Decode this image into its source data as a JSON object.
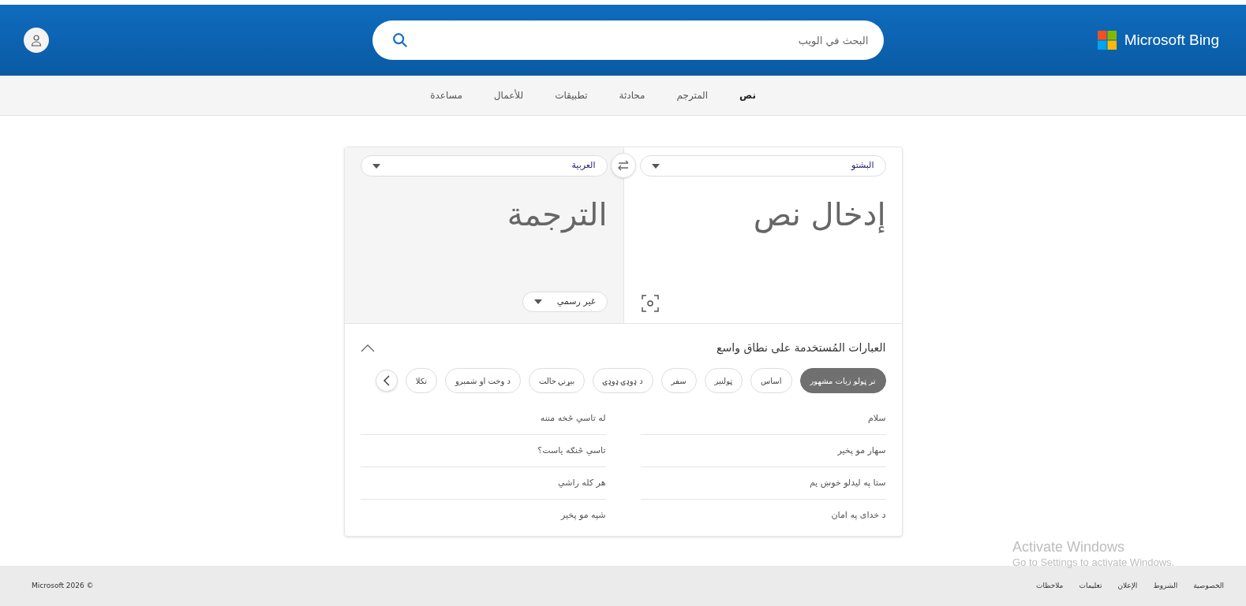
{
  "header": {
    "logo": "Microsoft Bing",
    "search": {
      "placeholder": "البحث في الويب"
    }
  },
  "nav": [
    {
      "label": "نص",
      "selected": true
    },
    {
      "label": "المترجم",
      "selected": false
    },
    {
      "label": "محادثة",
      "selected": false
    },
    {
      "label": "تطبيقات",
      "selected": false
    },
    {
      "label": "للأعمال",
      "selected": false
    },
    {
      "label": "مساعدة",
      "selected": false
    }
  ],
  "translator": {
    "source_language": "البشتو",
    "target_language": "العربية",
    "source": {
      "placeholder": "إدخال نص"
    },
    "target": {
      "placeholder": "الترجمة"
    },
    "tone": "غير رسمي"
  },
  "phrases": {
    "title": "العبارات المُستخدمة على نطاق واسع",
    "expanded": true,
    "categories": [
      {
        "label": "تر ټولو زیات مشهور",
        "selected": true
      },
      {
        "label": "اساس",
        "selected": false
      },
      {
        "label": "ټولنیز",
        "selected": false
      },
      {
        "label": "سفر",
        "selected": false
      },
      {
        "label": "د ډوډۍ ډوډۍ",
        "selected": false
      },
      {
        "label": "بیړنۍ حالت",
        "selected": false
      },
      {
        "label": "د وخت او شمېرو",
        "selected": false
      },
      {
        "label": "تکلا",
        "selected": false
      }
    ],
    "items": [
      "سلام",
      "له تاسي څخه مننه",
      "سهار مو پخیر",
      "تاسي څنګه یاست؟",
      "ستا په لیدلو خوښ یم",
      "هر کله راشي",
      "د خدای په امان",
      "شپه مو پخیر"
    ]
  },
  "os_notice": {
    "title": "Activate Windows",
    "text": "Go to Settings to activate Windows."
  },
  "footer": {
    "links": [
      "الخصوصية",
      "الشروط",
      "الإعلان",
      "تعليمات",
      "ملاحظات"
    ],
    "copyright": "Microsoft 2026 ©"
  }
}
